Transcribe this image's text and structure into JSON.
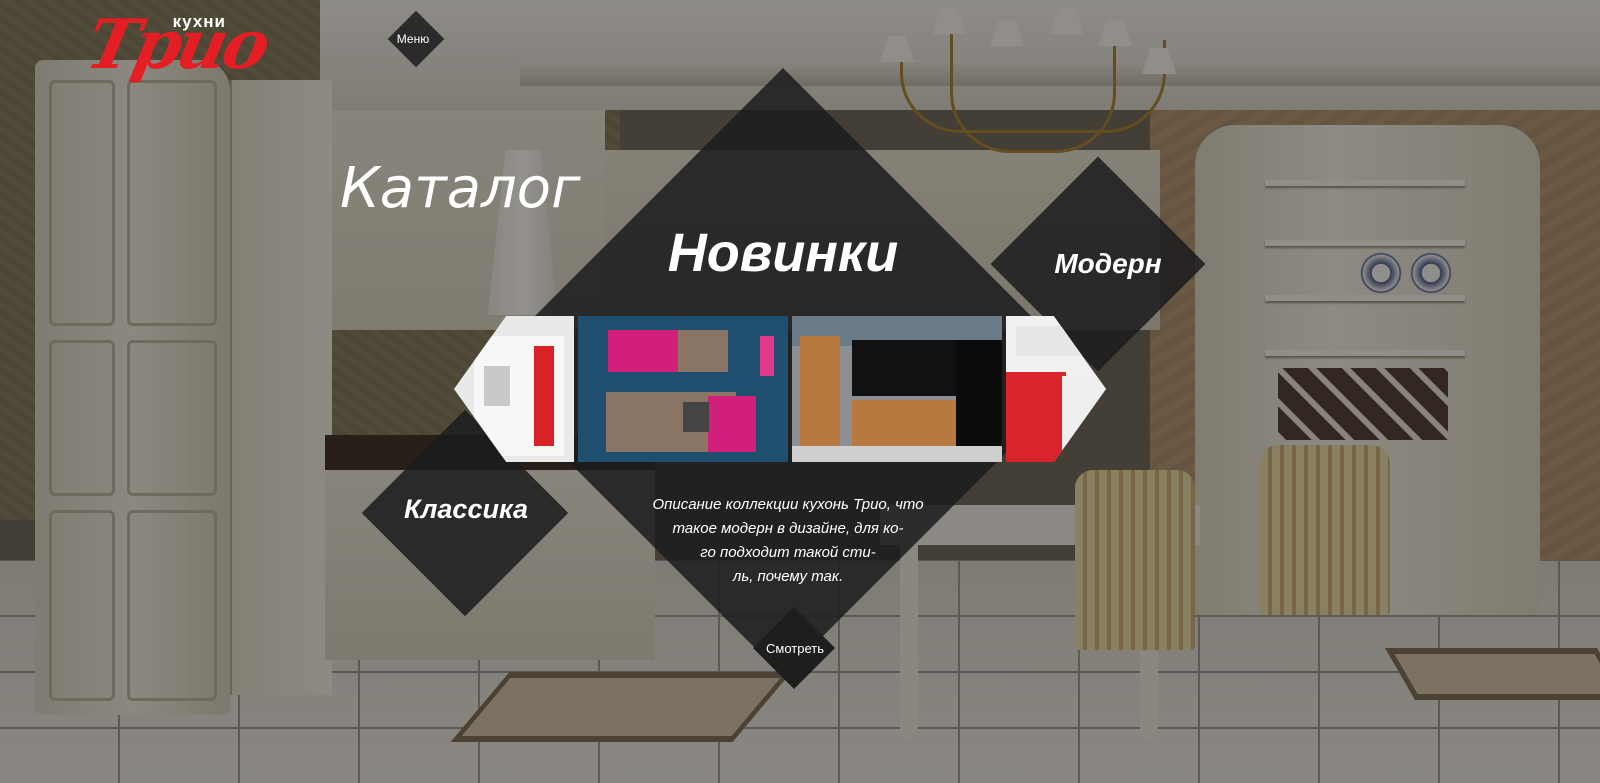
{
  "logo": {
    "brand": "Трио",
    "tagline": "кухни"
  },
  "nav": {
    "menu_label": "Меню"
  },
  "catalog": {
    "title": "Каталог"
  },
  "featured": {
    "title": "Новинки",
    "description": "Описание коллекции кухонь Трио, что такое модерн в дизайне, для ко- го подходит такой сти- ль, почему так.",
    "description_lines": [
      "Описание коллекции кухонь Трио, что",
      "такое модерн в дизайне, для ко-",
      "го подходит такой сти-",
      "ль, почему так."
    ],
    "view_label": "Смотреть"
  },
  "categories": {
    "modern": "Модерн",
    "classic": "Классика"
  },
  "gallery": [
    {
      "icon": "kitchen-photo-white-red"
    },
    {
      "icon": "kitchen-photo-pink-blue"
    },
    {
      "icon": "kitchen-photo-wood-black"
    },
    {
      "icon": "kitchen-photo-red-white"
    }
  ],
  "colors": {
    "brand_red": "#e31e24",
    "panel_dark": "#1c1c1e",
    "text": "#ffffff"
  }
}
